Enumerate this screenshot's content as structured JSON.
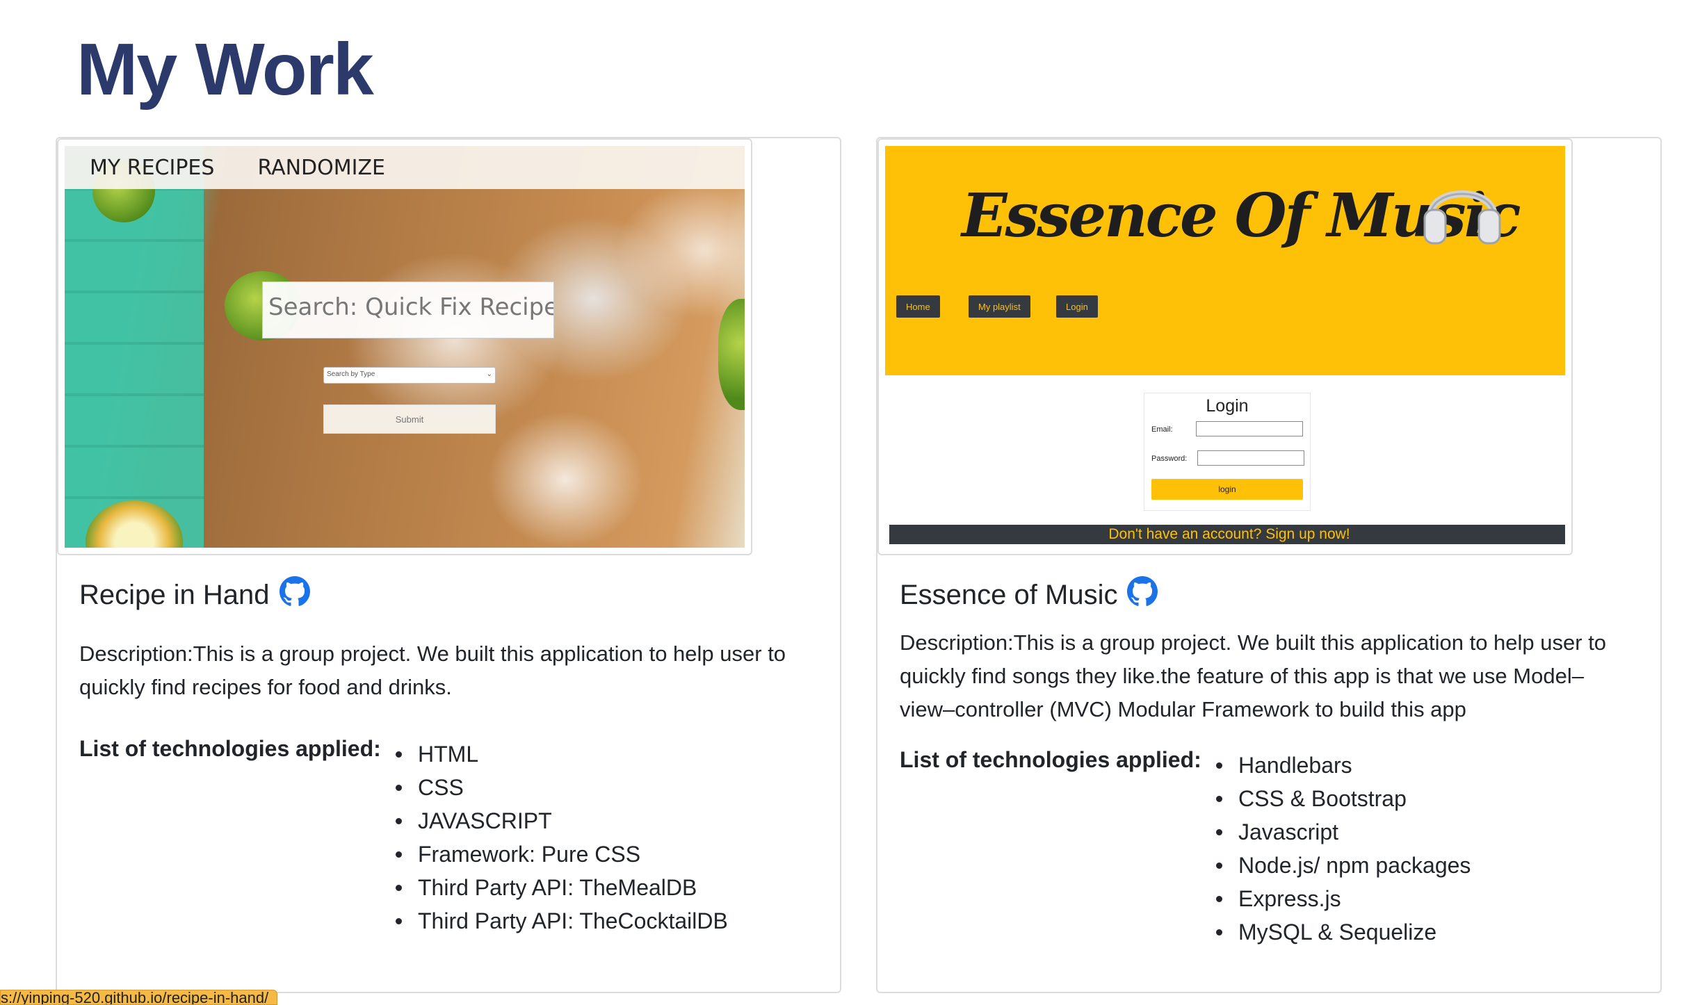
{
  "page": {
    "title": "My Work"
  },
  "projects": [
    {
      "title": "Recipe in Hand",
      "github_icon": "github-icon",
      "description": "Description:This is a group project. We built this application to help user to quickly find recipes for food and drinks.",
      "tech_label": "List of technologies applied:",
      "technologies": [
        "HTML",
        "CSS",
        "JAVASCRIPT",
        "Framework: Pure CSS",
        "Third Party API: TheMealDB",
        "Third Party API: TheCocktailDB"
      ],
      "screenshot": {
        "nav": [
          "MY RECIPES",
          "RANDOMIZE"
        ],
        "search_placeholder": "Search: Quick Fix Recipe...",
        "select_placeholder": "Search by Type",
        "submit_label": "Submit"
      }
    },
    {
      "title": "Essence of Music",
      "github_icon": "github-icon",
      "description": "Description:This is a group project. We built this application to help user to quickly find songs they like.the feature of this app is that we use Model–view–controller (MVC) Modular Framework to build this app",
      "tech_label": "List of technologies applied:",
      "technologies": [
        "Handlebars",
        "CSS & Bootstrap",
        "Javascript",
        "Node.js/ npm packages",
        "Express.js",
        "MySQL & Sequelize"
      ],
      "screenshot": {
        "logo": "Essence Of Music",
        "nav": [
          "Home",
          "My playlist",
          "Login"
        ],
        "login_title": "Login",
        "email_label": "Email:",
        "password_label": "Password:",
        "login_button": "login",
        "signup_text": "Don't have an account? Sign up now!"
      }
    }
  ],
  "status_bar": {
    "url": "s://yinping-520.github.io/recipe-in-hand/"
  },
  "colors": {
    "title": "#2b3a6b",
    "github": "#1a73e8",
    "music_yellow": "#ffc107",
    "dark": "#343a40"
  }
}
